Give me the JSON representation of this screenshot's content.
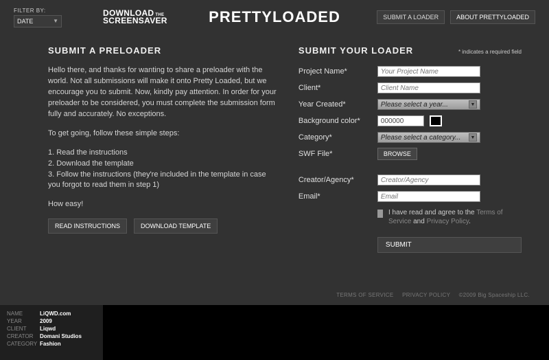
{
  "filter": {
    "label": "FILTER BY:",
    "value": "DATE"
  },
  "download_screensaver": {
    "line1": "DOWNLOAD",
    "the": "THE",
    "line2": "SCREENSAVER"
  },
  "logo": "PRETTYLOADED",
  "top_buttons": {
    "submit": "SUBMIT A LOADER",
    "about": "ABOUT PRETTYLOADED"
  },
  "left": {
    "heading": "SUBMIT A PRELOADER",
    "p1": "Hello there, and thanks for wanting to share a preloader with the world. Not all submissions will make it onto Pretty Loaded, but we encourage you to submit. Now, kindly pay attention. In order for your preloader to be considered, you must complete the submission form fully and accurately. No exceptions.",
    "p2": "To get going, follow these simple steps:",
    "p3": "1. Read the instructions",
    "p4": "2. Download the template",
    "p5": "3. Follow the instructions (they're included in the template in case you forgot to read them in step 1)",
    "p6": "How easy!",
    "btn_read": "READ INSTRUCTIONS",
    "btn_download": "DOWNLOAD TEMPLATE"
  },
  "right": {
    "heading": "SUBMIT YOUR LOADER",
    "required_note": "* indicates a required field",
    "fields": {
      "project_name": {
        "label": "Project Name*",
        "placeholder": "Your Project Name"
      },
      "client": {
        "label": "Client*",
        "placeholder": "Client Name"
      },
      "year": {
        "label": "Year Created*",
        "placeholder": "Please select a year..."
      },
      "bgcolor": {
        "label": "Background color*",
        "value": "000000"
      },
      "category": {
        "label": "Category*",
        "placeholder": "Please select a category..."
      },
      "swf": {
        "label": "SWF File*",
        "browse": "BROWSE"
      },
      "creator": {
        "label": "Creator/Agency*",
        "placeholder": "Creator/Agency"
      },
      "email": {
        "label": "Email*",
        "placeholder": "Email"
      }
    },
    "agree": {
      "pre": "I have read and agree to the ",
      "tos": "Terms of Service",
      "and": " and ",
      "pp": "Privacy Policy",
      "dot": "."
    },
    "submit": "SUBMIT"
  },
  "footer": {
    "tos": "TERMS OF SERVICE",
    "pp": "PRIVACY POLICY",
    "copy": "©2009 Big Spaceship LLC."
  },
  "info": {
    "name": {
      "k": "NAME",
      "v": "LiQWD.com"
    },
    "year": {
      "k": "YEAR",
      "v": "2009"
    },
    "client": {
      "k": "CLIENT",
      "v": "Liqwd"
    },
    "creator": {
      "k": "CREATOR",
      "v": "Domani Studios"
    },
    "category": {
      "k": "CATEGORY",
      "v": "Fashion"
    }
  }
}
